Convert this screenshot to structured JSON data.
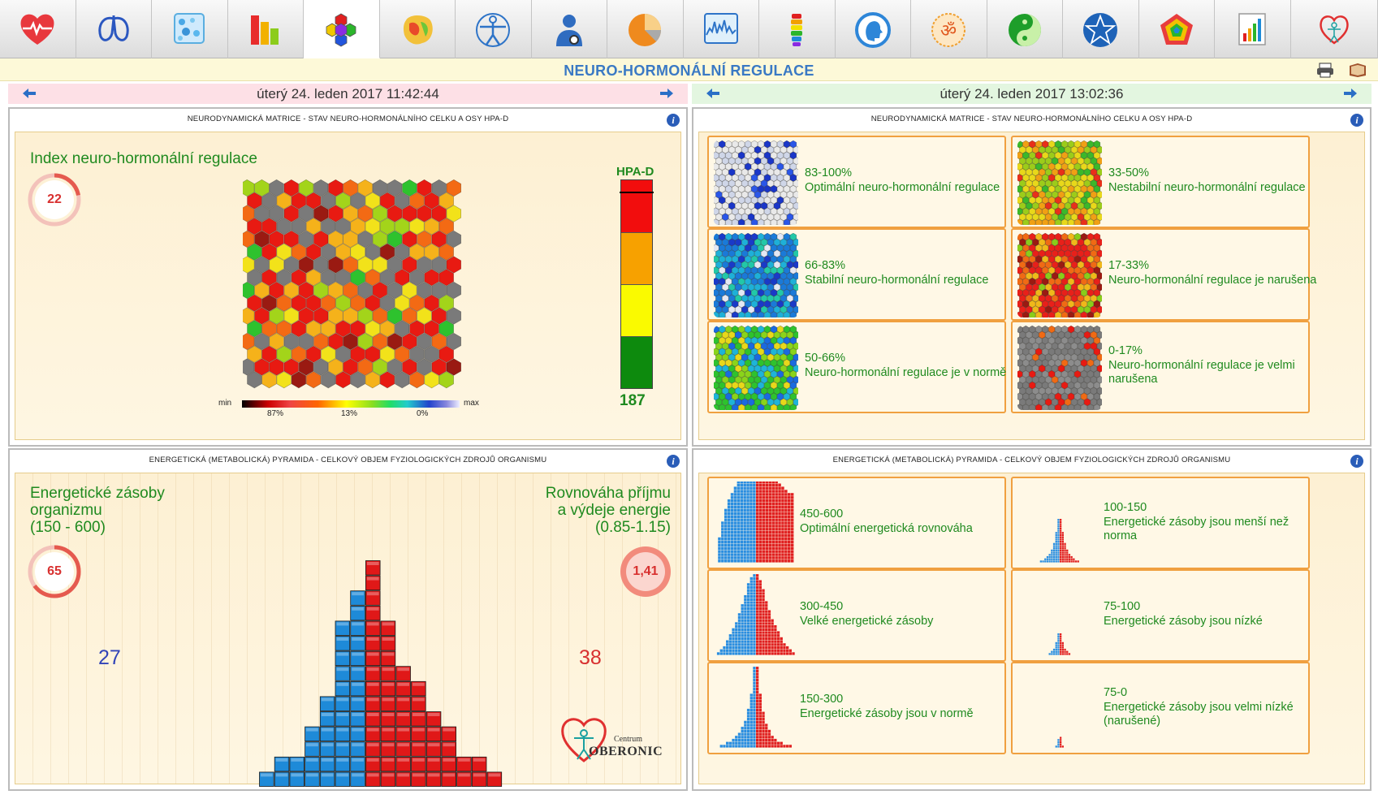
{
  "toolbar": {
    "tools": [
      {
        "icon": "heart-ecg-icon",
        "active": false
      },
      {
        "icon": "lungs-icon",
        "active": false
      },
      {
        "icon": "cells-icon",
        "active": false
      },
      {
        "icon": "bar-chart-icon",
        "active": false
      },
      {
        "icon": "hexagon-matrix-icon",
        "active": true
      },
      {
        "icon": "brain-map-icon",
        "active": false
      },
      {
        "icon": "vitruvian-man-icon",
        "active": false
      },
      {
        "icon": "person-stethoscope-icon",
        "active": false
      },
      {
        "icon": "pie-chart-icon",
        "active": false
      },
      {
        "icon": "spectrum-icon",
        "active": false
      },
      {
        "icon": "spine-icon",
        "active": false
      },
      {
        "icon": "head-profile-icon",
        "active": false
      },
      {
        "icon": "om-icon",
        "active": false
      },
      {
        "icon": "yin-yang-icon",
        "active": false
      },
      {
        "icon": "pentagram-icon",
        "active": false
      },
      {
        "icon": "radar-pentagon-icon",
        "active": false
      },
      {
        "icon": "report-bars-icon",
        "active": false
      },
      {
        "icon": "oberonic-logo-icon",
        "active": false
      }
    ]
  },
  "page": {
    "title": "NEURO-HORMONÁLNÍ REGULACE",
    "date_left": "úterý 24. leden 2017 11:42:44",
    "date_right": "úterý 24. leden 2017 13:02:36"
  },
  "matrix_panel": {
    "header": "NEURODYNAMICKÁ MATRICE - STAV NEURO-HORMONÁLNÍHO CELKU A OSY HPA-D",
    "index_label": "Index neuro-hormonální regulace",
    "index_value": "22",
    "index_fraction": 0.22,
    "hpa_label": "HPA-D",
    "hpa_value": "187",
    "scale_min": "min",
    "scale_max": "max",
    "scale_ticks": [
      "87%",
      "13%",
      "0%"
    ]
  },
  "matrix_legend": {
    "header": "NEURODYNAMICKÁ MATRICE - STAV NEURO-HORMONÁLNÍHO CELKU A OSY HPA-D",
    "items": [
      {
        "range": "83-100%",
        "text": "Optimální neuro-hormonální regulace",
        "palette": "white-blue"
      },
      {
        "range": "33-50%",
        "text": "Nestabilní neuro-hormonální regulace",
        "palette": "yellow-green"
      },
      {
        "range": "66-83%",
        "text": "Stabilní neuro-hormonální regulace",
        "palette": "blue"
      },
      {
        "range": "17-33%",
        "text": "Neuro-hormonální regulace je narušena",
        "palette": "red-orange"
      },
      {
        "range": "50-66%",
        "text": "Neuro-hormonální regulace je v normě",
        "palette": "green-blue"
      },
      {
        "range": "0-17%",
        "text": "Neuro-hormonální regulace je velmi narušena",
        "palette": "grey-red"
      }
    ]
  },
  "pyramid_panel": {
    "header": "ENERGETICKÁ (METABOLICKÁ) PYRAMIDA - CELKOVÝ OBJEM FYZIOLOGICKÝCH ZDROJŮ ORGANISMU",
    "left_title_1": "Energetické zásoby",
    "left_title_2": "organizmu",
    "left_title_3": "(150 - 600)",
    "left_value": "65",
    "left_fraction": 0.65,
    "right_title_1": "Rovnováha příjmu",
    "right_title_2": "a výdeje energie",
    "right_title_3": "(0.85-1.15)",
    "right_value": "1,41",
    "blue_count": "27",
    "red_count": "38",
    "logo_centrum": "Centrum",
    "logo_name": "OBERONIC",
    "blue_columns": [
      1,
      2,
      2,
      4,
      6,
      11,
      13
    ],
    "red_columns": [
      15,
      11,
      8,
      7,
      5,
      4,
      2,
      2,
      1
    ]
  },
  "pyramid_legend": {
    "header": "ENERGETICKÁ (METABOLICKÁ) PYRAMIDA - CELKOVÝ OBJEM FYZIOLOGICKÝCH ZDROJŮ ORGANISMU",
    "items": [
      {
        "range": "450-600",
        "text": "Optimální energetická rovnováha"
      },
      {
        "range": "100-150",
        "text": "Energetické zásoby jsou menší než norma"
      },
      {
        "range": "300-450",
        "text": "Velké energetické zásoby"
      },
      {
        "range": "75-100",
        "text": "Energetické zásoby jsou nízké"
      },
      {
        "range": "150-300",
        "text": "Energetické zásoby jsou v normě"
      },
      {
        "range": "75-0",
        "text": "Energetické zásoby jsou velmi nízké (narušené)"
      }
    ]
  },
  "colors": {
    "title_blue": "#3a79c4",
    "text_green": "#1f8a1f",
    "pyramid_blue": "#1e8ad8",
    "pyramid_red": "#e01818",
    "ring_red": "#e55a4e"
  }
}
